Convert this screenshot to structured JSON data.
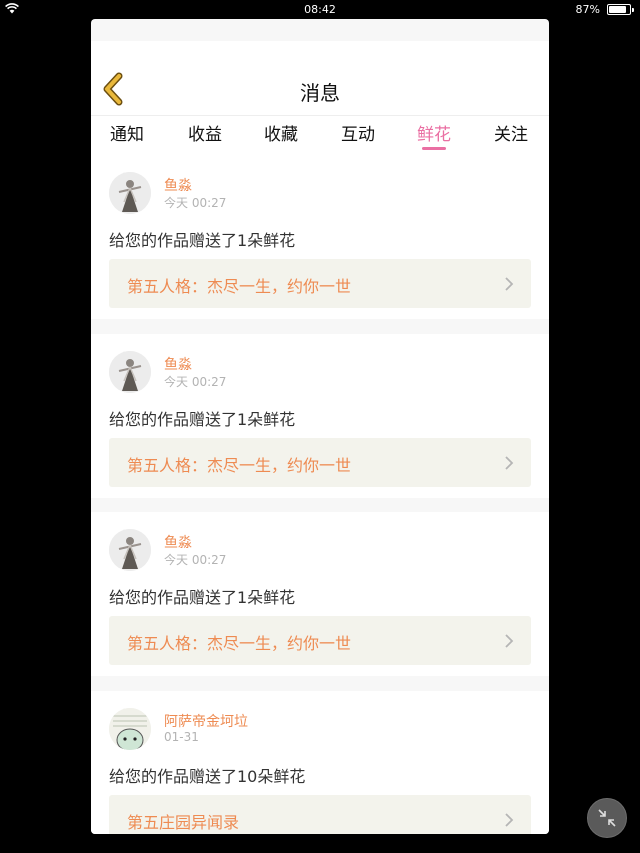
{
  "status_bar": {
    "time": "08:42",
    "battery_percent": "87%",
    "battery_level": 0.87
  },
  "nav": {
    "title": "消息"
  },
  "tabs": [
    {
      "label": "通知",
      "active": false
    },
    {
      "label": "收益",
      "active": false
    },
    {
      "label": "收藏",
      "active": false
    },
    {
      "label": "互动",
      "active": false
    },
    {
      "label": "鲜花",
      "active": true
    },
    {
      "label": "关注",
      "active": false
    }
  ],
  "messages": [
    {
      "user": "鱼淼",
      "time": "今天 00:27",
      "text": "给您的作品赠送了1朵鲜花",
      "work": "第五人格：杰尽一生，约你一世",
      "avatar": "figure-avatar"
    },
    {
      "user": "鱼淼",
      "time": "今天 00:27",
      "text": "给您的作品赠送了1朵鲜花",
      "work": "第五人格：杰尽一生，约你一世",
      "avatar": "figure-avatar"
    },
    {
      "user": "鱼淼",
      "time": "今天 00:27",
      "text": "给您的作品赠送了1朵鲜花",
      "work": "第五人格：杰尽一生，约你一世",
      "avatar": "figure-avatar"
    },
    {
      "user": "阿萨帝金坷垃",
      "time": "01-31",
      "text": "给您的作品赠送了10朵鲜花",
      "work": "第五庄园异闻录",
      "avatar": "cartoon-avatar"
    }
  ],
  "colors": {
    "accent": "#ea6fa3",
    "username": "#ee8b52",
    "back_icon": "#e9b83b"
  }
}
